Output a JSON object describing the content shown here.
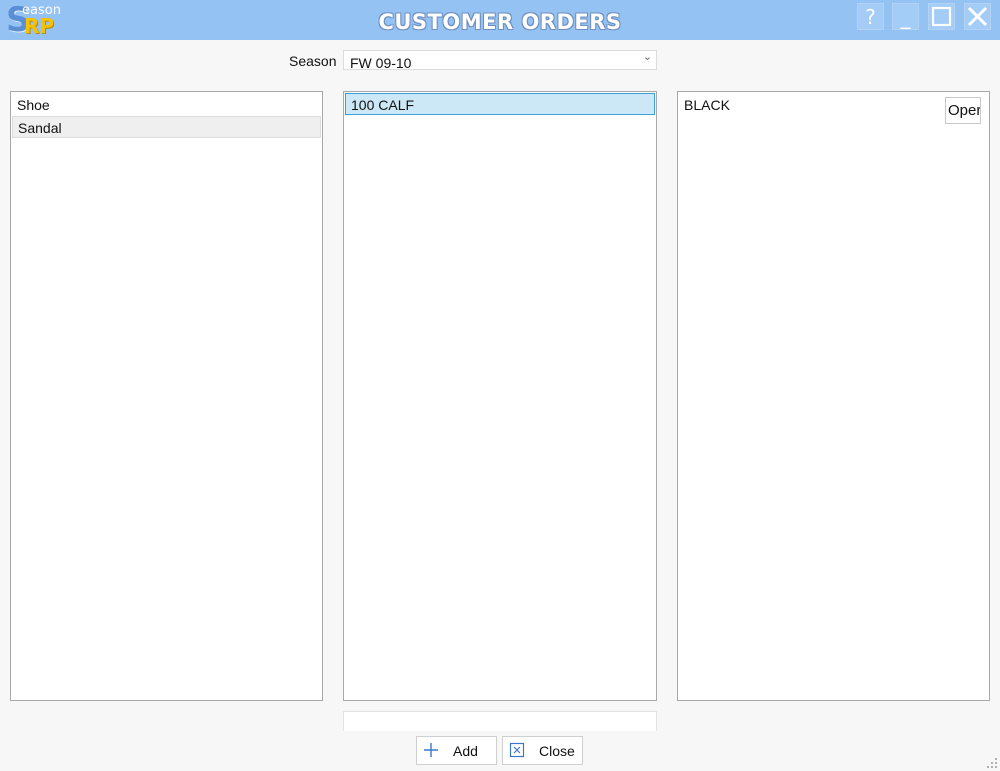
{
  "app": {
    "logo_text": "Season RP",
    "title": "CUSTOMER ORDERS",
    "window_buttons": {
      "help": "?",
      "minimize": "_",
      "close": "✕"
    },
    "colors": {
      "titlebar": "#93c2f3",
      "selection": "#cce8f6",
      "selection_border": "#3f9fd8"
    }
  },
  "filter": {
    "season_label": "Season",
    "season_value": "FW 09-10"
  },
  "lists": {
    "categories": [
      "Shoe",
      "Sandal"
    ],
    "materials": [
      "100 CALF"
    ],
    "colors": [
      "BLACK"
    ],
    "open_button_label": "Oper"
  },
  "footer": {
    "add_label": "Add",
    "close_label": "Close"
  }
}
